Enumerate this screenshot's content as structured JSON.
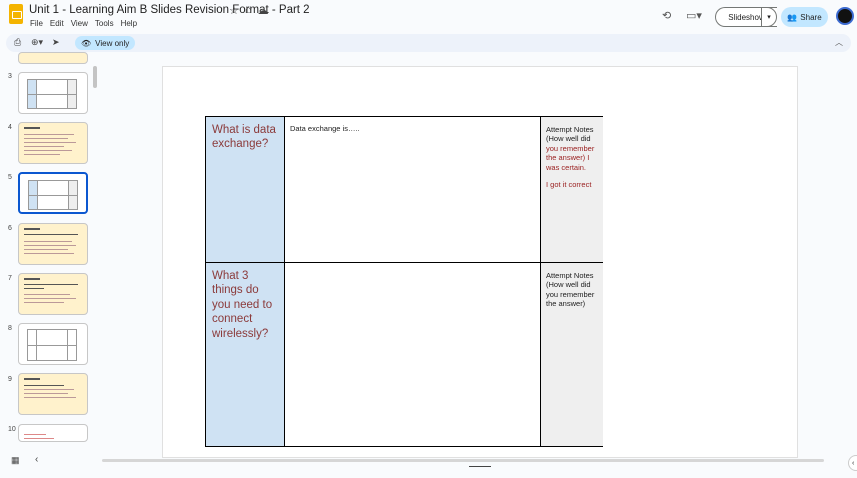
{
  "header": {
    "title": "Unit 1 - Learning Aim B Slides Revision Format - Part 2",
    "menus": [
      "File",
      "Edit",
      "View",
      "Tools",
      "Help"
    ],
    "slideshow_label": "Slideshow",
    "share_label": "Share"
  },
  "toolbar": {
    "view_only_label": "View only"
  },
  "sidebar": {
    "slide_numbers": [
      "3",
      "4",
      "5",
      "6",
      "7",
      "8",
      "9",
      "10"
    ]
  },
  "slide": {
    "row1": {
      "question": "What is data exchange?",
      "answer": "Data exchange is…..",
      "notes_label": "Attempt Notes (How well did",
      "notes_red": "you remember the answer) I was certain.",
      "notes_extra": "I got it correct"
    },
    "row2": {
      "question": "What 3 things do you need to connect wirelessly?",
      "answer": "",
      "notes_label": "Attempt Notes (How well did you remember the answer)"
    }
  },
  "colors": {
    "question_bg": "#cfe2f3",
    "question_text": "#8b3a3a",
    "notes_bg": "#efefef",
    "accent": "#0b57d0",
    "share_bg": "#c2e7ff"
  }
}
